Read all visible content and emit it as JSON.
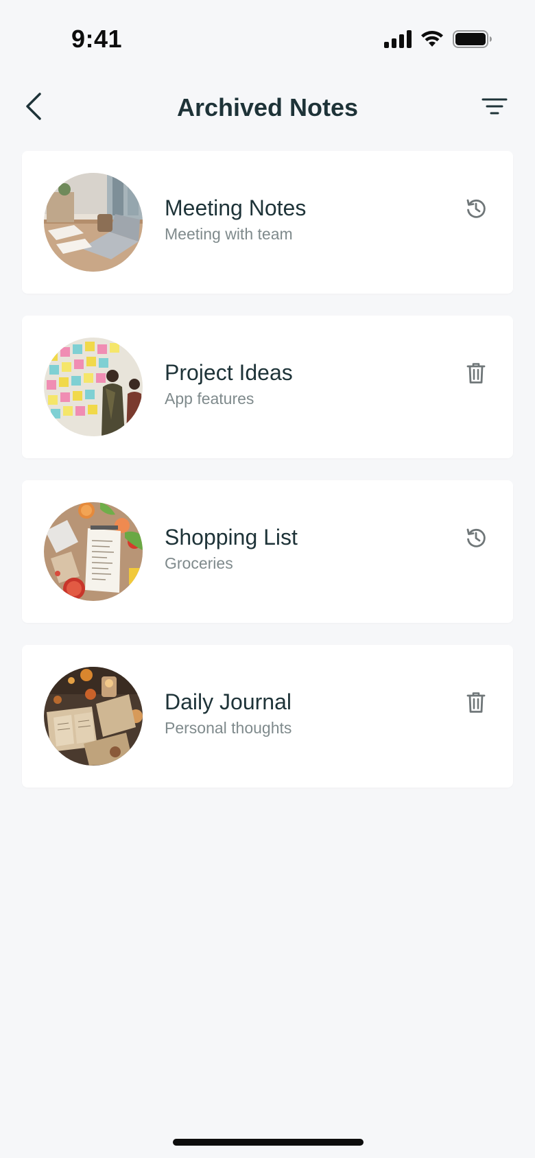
{
  "status_bar": {
    "time": "9:41"
  },
  "header": {
    "title": "Archived Notes",
    "back_icon": "chevron-left-icon",
    "filter_icon": "filter-icon"
  },
  "notes": [
    {
      "title": "Meeting Notes",
      "subtitle": "Meeting with team",
      "action_icon": "restore-icon",
      "thumbnail": "office desk with laptop"
    },
    {
      "title": "Project Ideas",
      "subtitle": "App features",
      "action_icon": "trash-icon",
      "thumbnail": "wall of sticky notes"
    },
    {
      "title": "Shopping List",
      "subtitle": "Groceries",
      "action_icon": "restore-icon",
      "thumbnail": "grocery list with vegetables"
    },
    {
      "title": "Daily Journal",
      "subtitle": "Personal thoughts",
      "action_icon": "trash-icon",
      "thumbnail": "open journals with candle"
    }
  ],
  "colors": {
    "background": "#f6f7f9",
    "card": "#ffffff",
    "title_text": "#1e3338",
    "subtitle_text": "#7f8a8c",
    "icon": "#6f7678"
  }
}
